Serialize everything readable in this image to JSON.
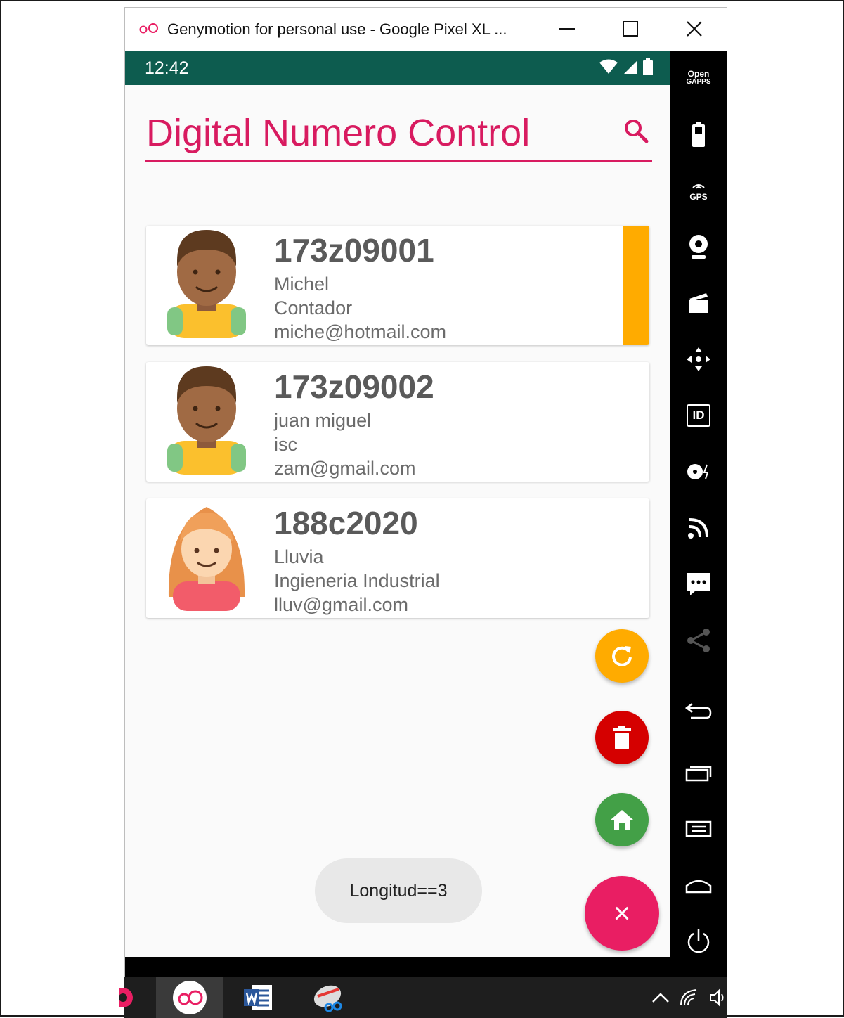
{
  "window": {
    "title": "Genymotion for personal use - Google Pixel XL ...",
    "minimize_label": "—",
    "close_label": "✕"
  },
  "status_bar": {
    "time": "12:42"
  },
  "app": {
    "title": "Digital Numero Control"
  },
  "records": [
    {
      "id": "173z09001",
      "name": "Michel",
      "career": "Contador",
      "email": "miche@hotmail.com",
      "avatar": "boy-avatar",
      "accent": "#ffab00"
    },
    {
      "id": "173z09002",
      "name": "juan miguel",
      "career": "isc",
      "email": "zam@gmail.com",
      "avatar": "boy-avatar"
    },
    {
      "id": "188c2020",
      "name": "Lluvia",
      "career": "Ingieneria Industrial",
      "email": "lluv@gmail.com",
      "avatar": "girl-avatar"
    }
  ],
  "fabs": {
    "refresh": {
      "icon": "refresh-icon",
      "color": "#ffab00"
    },
    "delete": {
      "icon": "trash-icon",
      "color": "#d50000"
    },
    "home": {
      "icon": "home-icon",
      "color": "#43a047"
    },
    "close": {
      "icon": "close-icon",
      "label": "×",
      "color": "#e91e63"
    }
  },
  "toast": {
    "text": "Longitud==3"
  },
  "sidebar": {
    "opengapps_label_1": "Open",
    "opengapps_label_2": "GAPPS",
    "gps_label": "GPS",
    "id_label": "ID"
  },
  "colors": {
    "status_bar": "#0d5c4f",
    "primary": "#d81b60",
    "accent": "#ffab00"
  }
}
